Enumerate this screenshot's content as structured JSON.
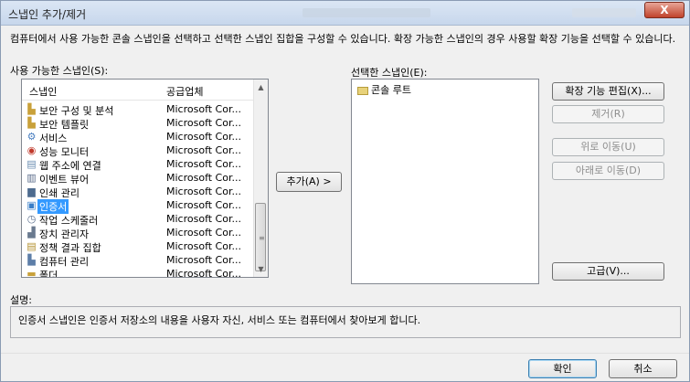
{
  "window": {
    "title": "스냅인 추가/제거",
    "close_glyph": "X"
  },
  "description": "컴퓨터에서 사용 가능한 콘솔 스냅인을 선택하고 선택한 스냅인 집합을 구성할 수 있습니다. 확장 가능한 스냅인의 경우 사용할 확장 기능을 선택할 수 있습니다.",
  "available": {
    "label": "사용 가능한 스냅인(S):",
    "columns": [
      "스냅인",
      "공급업체"
    ],
    "items": [
      {
        "name": "보안 구성 및 분석",
        "vendor": "Microsoft Cor...",
        "icon": "security-config-icon",
        "glyph": "▙"
      },
      {
        "name": "보안 템플릿",
        "vendor": "Microsoft Cor...",
        "icon": "security-template-icon",
        "glyph": "▙"
      },
      {
        "name": "서비스",
        "vendor": "Microsoft Cor...",
        "icon": "services-gear-icon",
        "glyph": "⚙"
      },
      {
        "name": "성능 모니터",
        "vendor": "Microsoft Cor...",
        "icon": "performance-monitor-icon",
        "glyph": "◉"
      },
      {
        "name": "웹 주소에 연결",
        "vendor": "Microsoft Cor...",
        "icon": "web-link-icon",
        "glyph": "▤"
      },
      {
        "name": "이벤트 뷰어",
        "vendor": "Microsoft Cor...",
        "icon": "event-viewer-icon",
        "glyph": "▥"
      },
      {
        "name": "인쇄 관리",
        "vendor": "Microsoft Cor...",
        "icon": "print-management-icon",
        "glyph": "▆"
      },
      {
        "name": "인증서",
        "vendor": "Microsoft Cor...",
        "icon": "certificates-icon",
        "glyph": "▣",
        "selected": true
      },
      {
        "name": "작업 스케줄러",
        "vendor": "Microsoft Cor...",
        "icon": "task-scheduler-clock-icon",
        "glyph": "◷"
      },
      {
        "name": "장치 관리자",
        "vendor": "Microsoft Cor...",
        "icon": "device-manager-icon",
        "glyph": "▟"
      },
      {
        "name": "정책 결과 집합",
        "vendor": "Microsoft Cor...",
        "icon": "policy-result-icon",
        "glyph": "▤"
      },
      {
        "name": "컴퓨터 관리",
        "vendor": "Microsoft Cor...",
        "icon": "computer-management-icon",
        "glyph": "▙"
      },
      {
        "name": "폴더",
        "vendor": "Microsoft Cor...",
        "icon": "folder-icon",
        "glyph": "▬"
      }
    ]
  },
  "add_button": "추가(A) >",
  "selected": {
    "label": "선택한 스냅인(E):",
    "root_item": "콘솔 루트"
  },
  "side_buttons": {
    "edit_extensions": "확장 기능 편집(X)...",
    "remove": "제거(R)",
    "move_up": "위로 이동(U)",
    "move_down": "아래로 이동(D)",
    "advanced": "고급(V)..."
  },
  "explanation": {
    "label": "설명:",
    "text": "인증서 스냅인은 인증서 저장소의 내용을 사용자 자신, 서비스 또는 컴퓨터에서 찾아보게 합니다."
  },
  "footer": {
    "ok": "확인",
    "cancel": "취소"
  }
}
